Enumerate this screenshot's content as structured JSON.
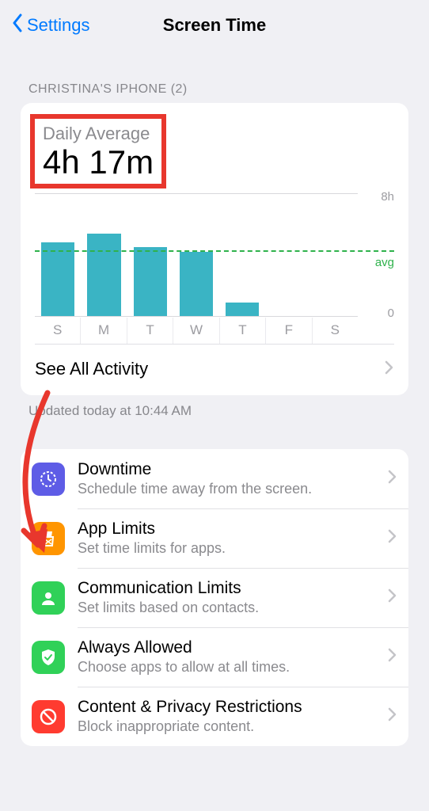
{
  "nav": {
    "back_label": "Settings",
    "title": "Screen Time"
  },
  "section_header": "CHRISTINA'S IPHONE (2)",
  "daily_avg": {
    "label": "Daily Average",
    "value": "4h 17m"
  },
  "chart_data": {
    "type": "bar",
    "categories": [
      "S",
      "M",
      "T",
      "W",
      "T",
      "F",
      "S"
    ],
    "values": [
      4.8,
      5.4,
      4.5,
      4.2,
      0.9,
      0,
      0
    ],
    "ylabel": "",
    "ylim": [
      0,
      8
    ],
    "ticks": {
      "y8": "8h",
      "y0": "0"
    },
    "avg_label": "avg",
    "avg_value": 4.28
  },
  "see_all": "See All Activity",
  "updated": "Updated today at 10:44 AM",
  "rows": [
    {
      "key": "downtime",
      "title": "Downtime",
      "sub": "Schedule time away from the screen.",
      "color": "#5e5ce6"
    },
    {
      "key": "app-limits",
      "title": "App Limits",
      "sub": "Set time limits for apps.",
      "color": "#ff9500"
    },
    {
      "key": "comm-limits",
      "title": "Communication Limits",
      "sub": "Set limits based on contacts.",
      "color": "#30d158"
    },
    {
      "key": "always-allowed",
      "title": "Always Allowed",
      "sub": "Choose apps to allow at all times.",
      "color": "#30d158"
    },
    {
      "key": "content-privacy",
      "title": "Content & Privacy Restrictions",
      "sub": "Block inappropriate content.",
      "color": "#ff3b30"
    }
  ],
  "annotation": {
    "highlight_box": true,
    "arrow_to": "app-limits"
  }
}
